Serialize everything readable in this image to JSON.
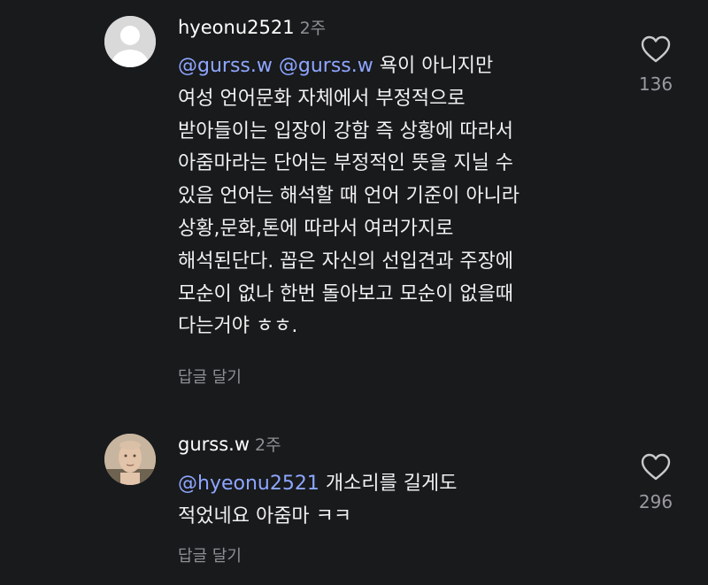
{
  "comments": [
    {
      "username": "hyeonu2521",
      "time": "2주",
      "mentions": [
        "@gurss.w",
        "@gurss.w"
      ],
      "lines": [
        "욕이 아니지만",
        "여성 언어문화 자체에서 부정적으로",
        "받아들이는 입장이 강함 즉 상황에 따라서",
        "아줌마라는 단어는 부정적인 뜻을 지닐 수",
        "있음 언어는 해석할 때 언어 기준이 아니라",
        "상황,문화,톤에 따라서 여러가지로",
        "해석된단다. 꼽은 자신의 선입견과 주장에",
        "모순이 없나 한번 돌아보고 모순이 없을때",
        "다는거야 ㅎㅎ."
      ],
      "reply_label": "답글 달기",
      "like_count": "136",
      "avatar_icon": "default-profile-icon"
    },
    {
      "username": "gurss.w",
      "time": "2주",
      "mentions": [
        "@hyeonu2521"
      ],
      "lines": [
        "개소리를 길게도",
        "적었네요 아줌마 ㅋㅋ"
      ],
      "reply_label": "답글 달기",
      "like_count": "296",
      "avatar_icon": "profile-photo"
    }
  ],
  "colors": {
    "background": "#181a1c",
    "mention": "#8ea6ff",
    "muted": "#8f8f94",
    "text": "#f0f0f0"
  }
}
